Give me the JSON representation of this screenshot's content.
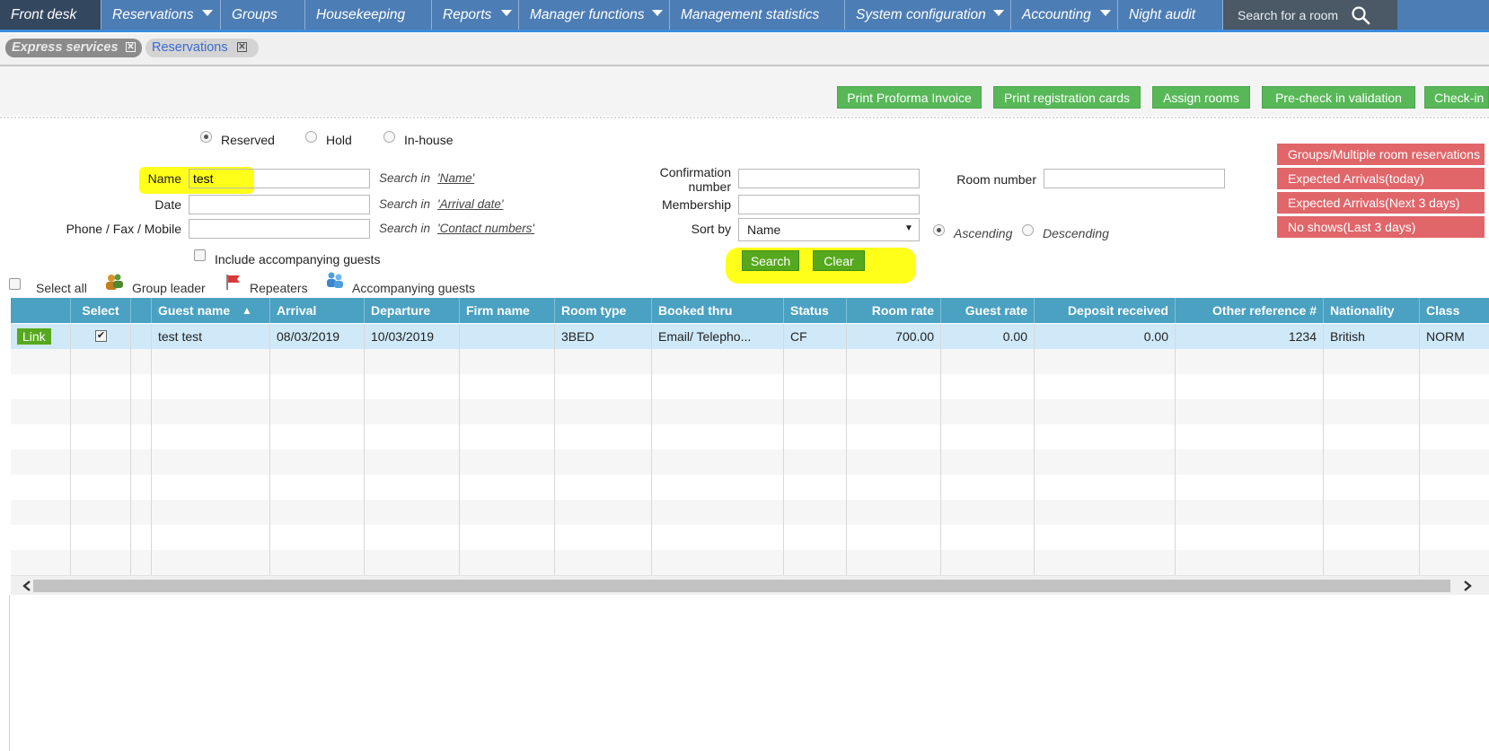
{
  "nav": {
    "items": [
      {
        "label": "Front desk",
        "caret": false
      },
      {
        "label": "Reservations",
        "caret": true
      },
      {
        "label": "Groups",
        "caret": false
      },
      {
        "label": "Housekeeping",
        "caret": false
      },
      {
        "label": "Reports",
        "caret": true
      },
      {
        "label": "Manager functions",
        "caret": true
      },
      {
        "label": "Management statistics",
        "caret": false
      },
      {
        "label": "System configuration",
        "caret": true
      },
      {
        "label": "Accounting",
        "caret": true
      },
      {
        "label": "Night audit",
        "caret": false
      }
    ],
    "search_placeholder": "Search for a room"
  },
  "tabs": {
    "express": "Express services",
    "reservations": "Reservations",
    "close_glyph": "✕"
  },
  "actions": {
    "print_proforma": "Print Proforma Invoice",
    "print_reg_cards": "Print registration cards",
    "assign_rooms": "Assign rooms",
    "precheck": "Pre-check in validation",
    "checkin": "Check-in"
  },
  "quick_filters": {
    "groups": "Groups/Multiple room reservations",
    "arrivals_today": "Expected Arrivals(today)",
    "arrivals_next3": "Expected Arrivals(Next 3 days)",
    "no_shows": "No shows(Last 3 days)"
  },
  "status_filter": {
    "reserved": "Reserved",
    "hold": "Hold",
    "inhouse": "In-house",
    "selected": "reserved"
  },
  "form": {
    "name_label": "Name",
    "name_value": "test",
    "date_label": "Date",
    "phone_label": "Phone / Fax / Mobile",
    "search_in": "Search in",
    "name_field_link": "'Name'",
    "date_field_link": "'Arrival date'",
    "contact_field_link": "'Contact numbers'",
    "confirmation_label_1": "Confirmation",
    "confirmation_label_2": "number",
    "membership_label": "Membership",
    "sort_label": "Sort by",
    "sort_value": "Name",
    "ascending": "Ascending",
    "descending": "Descending",
    "room_number_label": "Room number",
    "include_accompanying": "Include accompanying guests",
    "search_button": "Search",
    "clear_button": "Clear"
  },
  "legend": {
    "select_all": "Select all",
    "group_leader": "Group leader",
    "repeaters": "Repeaters",
    "accompanying": "Accompanying guests"
  },
  "table": {
    "headers": [
      "",
      "Select",
      "",
      "Guest name",
      "Arrival",
      "Departure",
      "Firm name",
      "Room type",
      "Booked thru",
      "Status",
      "Room rate",
      "Guest rate",
      "Deposit received",
      "Other reference #",
      "Nationality",
      "Class"
    ],
    "sort_indicator": "▲",
    "row": {
      "link": "Link",
      "guest_name": "test test",
      "arrival": "08/03/2019",
      "departure": "10/03/2019",
      "firm_name": "",
      "room_type": "3BED",
      "booked_thru": "Email/ Telepho...",
      "status": "CF",
      "room_rate": "700.00",
      "guest_rate": "0.00",
      "deposit": "0.00",
      "other_ref": "1234",
      "nationality": "British",
      "class": "NORM"
    }
  },
  "colors": {
    "nav": "#4d7db5",
    "nav_active": "#33475f",
    "green": "#58b858",
    "red": "#e0666a",
    "table_header": "#4aa1c2",
    "selected_row": "#cfe9f8",
    "highlight": "#ffff1a"
  }
}
